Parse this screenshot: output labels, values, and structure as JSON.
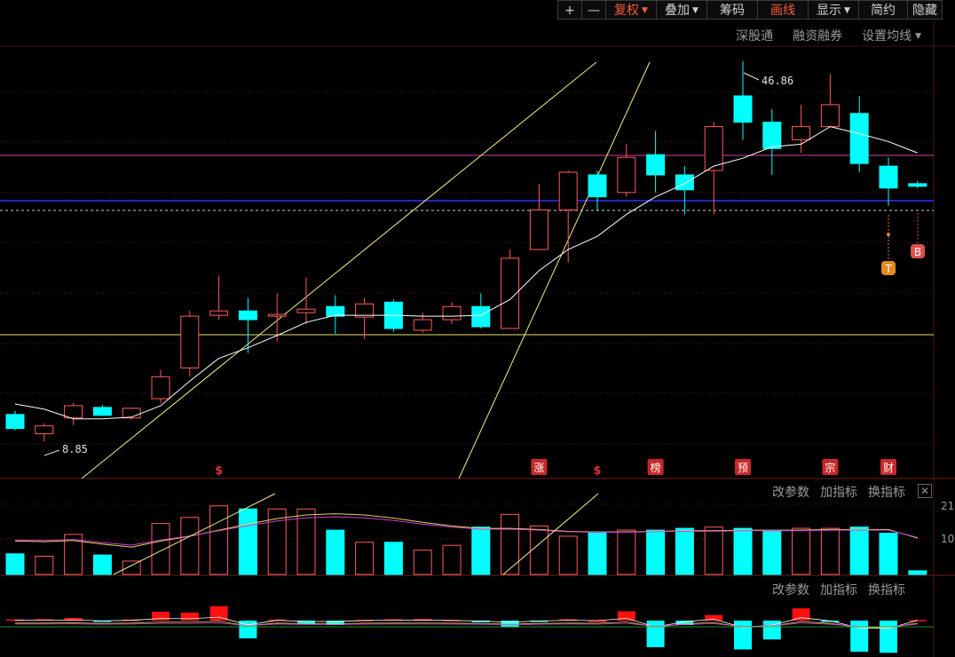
{
  "toolbar": {
    "buttons": [
      {
        "label": "+",
        "icon": "plus-icon"
      },
      {
        "label": "—",
        "icon": "minus-icon"
      },
      {
        "label": "复权",
        "dropdown": true,
        "active": true
      },
      {
        "label": "叠加",
        "dropdown": true
      },
      {
        "label": "筹码"
      },
      {
        "label": "画线",
        "active": true
      },
      {
        "label": "显示",
        "dropdown": true
      },
      {
        "label": "简约"
      },
      {
        "label": "隐藏"
      }
    ]
  },
  "subbar": {
    "items": [
      "深股通",
      "融资融券",
      "设置均线"
    ]
  },
  "main_chart": {
    "high_label": "46.86",
    "low_label": "8.85",
    "event_markers": [
      "$",
      "涨",
      "$",
      "榜",
      "预",
      "宗",
      "财"
    ],
    "signal_markers": [
      "T",
      "B"
    ]
  },
  "panel_controls": [
    "改参数",
    "加指标",
    "换指标"
  ],
  "volume_axis": [
    "21",
    "10"
  ],
  "colors": {
    "up": "#ff5a5a",
    "down": "#00ffff",
    "ma": "#ffffff",
    "trend": "#f0f08c",
    "accent": "#ff5a3c",
    "marker": "#c82828"
  },
  "chart_data": {
    "type": "candlestick",
    "candles": [
      {
        "o": 12.2,
        "h": 12.6,
        "l": 10.4,
        "c": 10.6
      },
      {
        "o": 10.0,
        "h": 11.2,
        "l": 9.1,
        "c": 10.9
      },
      {
        "o": 11.8,
        "h": 13.5,
        "l": 11.0,
        "c": 13.2
      },
      {
        "o": 13.0,
        "h": 13.3,
        "l": 12.0,
        "c": 12.1
      },
      {
        "o": 11.8,
        "h": 13.0,
        "l": 11.6,
        "c": 12.9
      },
      {
        "o": 14.0,
        "h": 17.3,
        "l": 13.5,
        "c": 16.5
      },
      {
        "o": 17.5,
        "h": 24.0,
        "l": 16.5,
        "c": 23.4
      },
      {
        "o": 23.5,
        "h": 28.0,
        "l": 23.0,
        "c": 24.0
      },
      {
        "o": 24.0,
        "h": 25.5,
        "l": 19.2,
        "c": 23.0
      },
      {
        "o": 23.4,
        "h": 26.0,
        "l": 20.5,
        "c": 23.6
      },
      {
        "o": 23.8,
        "h": 27.8,
        "l": 22.5,
        "c": 24.2
      },
      {
        "o": 24.5,
        "h": 25.8,
        "l": 21.4,
        "c": 23.4
      },
      {
        "o": 23.3,
        "h": 25.5,
        "l": 20.8,
        "c": 24.8
      },
      {
        "o": 25.0,
        "h": 25.3,
        "l": 21.6,
        "c": 22.0
      },
      {
        "o": 21.8,
        "h": 23.8,
        "l": 21.5,
        "c": 23.0
      },
      {
        "o": 23.0,
        "h": 25.0,
        "l": 22.5,
        "c": 24.5
      },
      {
        "o": 24.5,
        "h": 26.0,
        "l": 22.0,
        "c": 22.2
      },
      {
        "o": 22.0,
        "h": 31.0,
        "l": 22.0,
        "c": 30.0
      },
      {
        "o": 31.0,
        "h": 38.5,
        "l": 31.0,
        "c": 35.5
      },
      {
        "o": 35.5,
        "h": 40.0,
        "l": 29.5,
        "c": 39.8
      },
      {
        "o": 39.5,
        "h": 40.0,
        "l": 35.5,
        "c": 37.0
      },
      {
        "o": 37.5,
        "h": 43.0,
        "l": 37.0,
        "c": 41.5
      },
      {
        "o": 41.8,
        "h": 44.5,
        "l": 37.5,
        "c": 39.5
      },
      {
        "o": 39.5,
        "h": 40.5,
        "l": 35.0,
        "c": 37.8
      },
      {
        "o": 40.0,
        "h": 45.5,
        "l": 35.0,
        "c": 45.0
      },
      {
        "o": 48.5,
        "h": 52.5,
        "l": 43.5,
        "c": 45.5
      },
      {
        "o": 45.5,
        "h": 47.0,
        "l": 39.5,
        "c": 42.5
      },
      {
        "o": 43.5,
        "h": 47.5,
        "l": 42.0,
        "c": 45.0
      },
      {
        "o": 45.0,
        "h": 51.0,
        "l": 45.0,
        "c": 47.5
      },
      {
        "o": 46.5,
        "h": 48.5,
        "l": 39.8,
        "c": 40.8
      },
      {
        "o": 40.5,
        "h": 41.5,
        "l": 36.0,
        "c": 38.0
      },
      {
        "o": 38.5,
        "h": 38.8,
        "l": 38.0,
        "c": 38.2
      }
    ],
    "ma": [
      13.4,
      12.8,
      11.7,
      11.7,
      11.9,
      13.2,
      16.0,
      18.6,
      19.8,
      21.2,
      22.7,
      23.5,
      23.5,
      23.5,
      23.4,
      23.4,
      23.5,
      25.3,
      28.6,
      31.0,
      32.5,
      35.0,
      37.0,
      38.5,
      40.5,
      41.4,
      42.7,
      43.0,
      45.0,
      44.2,
      43.3,
      42.0
    ],
    "volume": [
      34,
      30,
      66,
      32,
      22,
      84,
      94,
      113,
      108,
      108,
      108,
      73,
      53,
      53,
      40,
      48,
      78,
      99,
      80,
      63,
      70,
      73,
      73,
      76,
      78,
      76,
      71,
      76,
      76,
      78,
      68,
      6
    ],
    "volume_ma": [
      55,
      54,
      56,
      50,
      45,
      55,
      63,
      73,
      83,
      92,
      98,
      100,
      98,
      93,
      86,
      80,
      76,
      76,
      74,
      71,
      70,
      70,
      71,
      72,
      72,
      73,
      73,
      73,
      74,
      74,
      74,
      60
    ],
    "macd": [
      0.5,
      0.6,
      1.2,
      -0.4,
      0.5,
      4.0,
      3.6,
      6.5,
      -8.0,
      0.5,
      -1.5,
      -2.0,
      0.3,
      0.6,
      0.7,
      0.3,
      -0.8,
      -3.0,
      -0.6,
      0.6,
      0.0,
      4.2,
      -12.0,
      -2.0,
      2.5,
      -13.0,
      -8.5,
      5.5,
      -0.5,
      -14.0,
      -14.5,
      0.3
    ]
  }
}
